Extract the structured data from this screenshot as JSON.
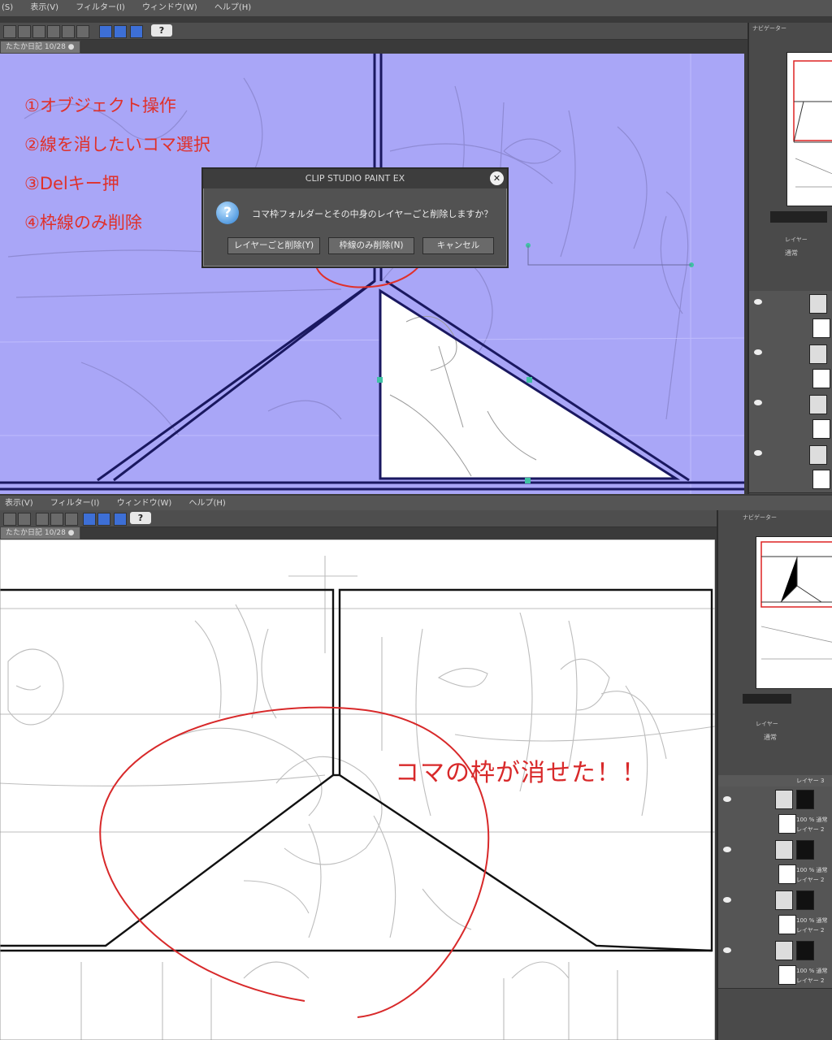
{
  "top_window": {
    "menu": [
      "(S)",
      "表示(V)",
      "フィルター(I)",
      "ウィンドウ(W)",
      "ヘルプ(H)"
    ],
    "doc_tab": "たたか日記 10/28 ●",
    "help_button": "?"
  },
  "annotations": {
    "step1": "①オブジェクト操作",
    "step2": "②線を消したいコマ選択",
    "step3": "③Delキー押",
    "step4": "④枠線のみ削除",
    "result": "コマの枠が消せた！！"
  },
  "dialog": {
    "title": "CLIP STUDIO PAINT EX",
    "message": "コマ枠フォルダーとその中身のレイヤーごと削除しますか？",
    "icon": "?",
    "buttons": {
      "delete_with_layers": "レイヤーごと削除(Y)",
      "delete_frame_only": "枠線のみ削除(N)",
      "cancel": "キャンセル"
    },
    "close": "✕"
  },
  "bottom_window": {
    "menu": [
      "表示(V)",
      "フィルター(I)",
      "ウィンドウ(W)",
      "ヘルプ(H)"
    ],
    "doc_tab": "たたか日記 10/28 ●",
    "help_button": "?"
  },
  "right_panel": {
    "navigator_label": "ナビゲーター",
    "layer_tab": "レイヤー",
    "blend_mode": "通常",
    "layers": [
      {
        "name": "レイヤー 3",
        "info": "100 % 通常"
      },
      {
        "name": "レイヤー 2",
        "info": "100 % 通常"
      },
      {
        "name": "レイヤー 2",
        "info": "100 % 通常"
      },
      {
        "name": "レイヤー 2",
        "info": "100 % 通常"
      },
      {
        "name": "レイヤー 2",
        "info": "100 % 通常"
      }
    ]
  },
  "colors": {
    "selection_fill": "#a9a6f7",
    "annotation_red": "#e0302a",
    "frame_line": "#111111",
    "ui_dark": "#4a4a4a"
  }
}
